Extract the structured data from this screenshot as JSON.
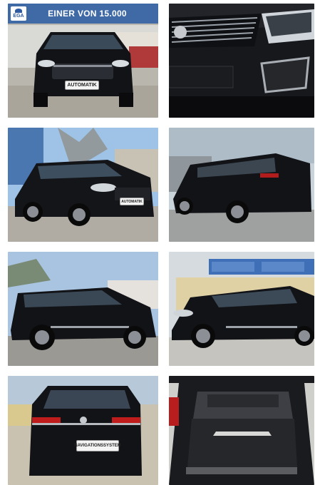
{
  "banner": {
    "logo_text": "EGA",
    "title": "EINER VON 15.000"
  },
  "plates": {
    "front_1": "AUTOMATIK",
    "front_3": "AUTOMATIK",
    "rear_7": "NAVIGATIONSSYSTEM"
  },
  "icons": {
    "logo": "ega-logo-icon"
  }
}
